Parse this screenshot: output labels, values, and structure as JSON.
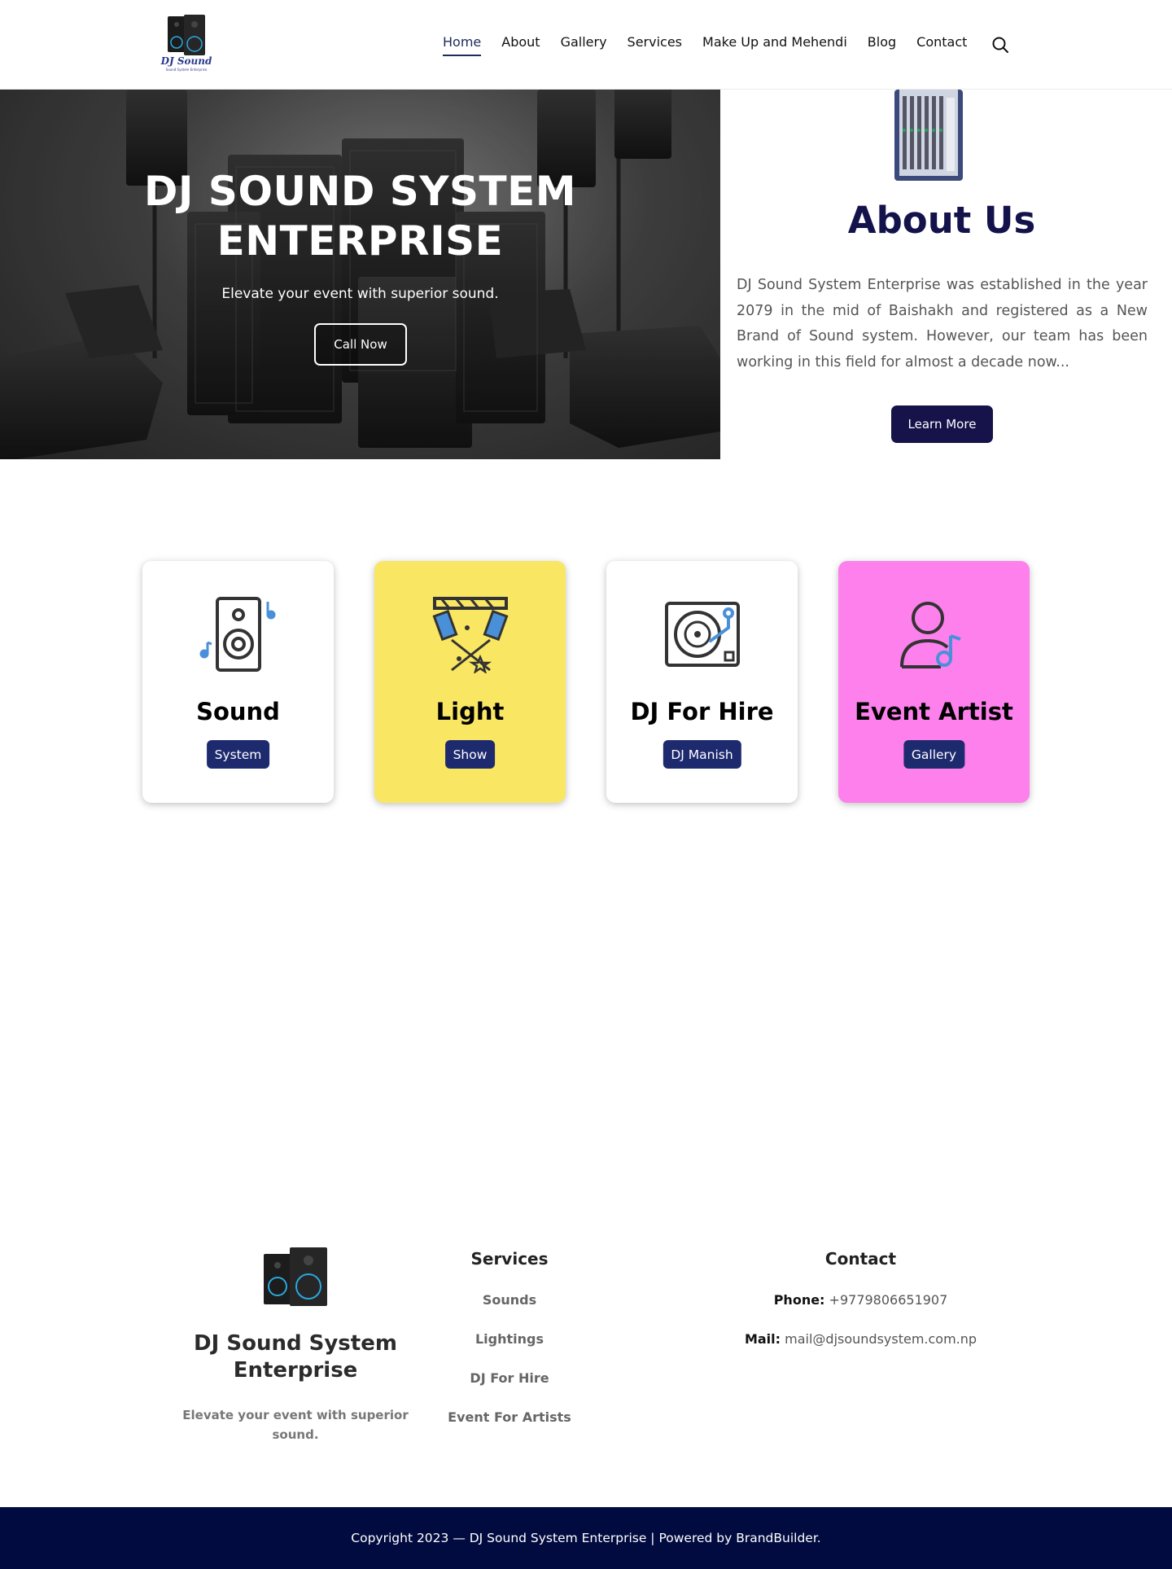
{
  "header": {
    "logo_text": "DJ Sound",
    "logo_subtext": "Sound System Enterprise",
    "nav": [
      "Home",
      "About",
      "Gallery",
      "Services",
      "Make Up and Mehendi",
      "Blog",
      "Contact"
    ],
    "active_nav": "Home"
  },
  "hero": {
    "title": "DJ SOUND SYSTEM ENTERPRISE",
    "subtitle": "Elevate your event with superior sound.",
    "cta": "Call Now"
  },
  "about": {
    "title": "About Us",
    "text": "DJ Sound System Enterprise was established in the year  2079 in the mid of Baishakh and registered as a New Brand of Sound system. However, our team has been working in this field for almost a decade now...",
    "button": "Learn More"
  },
  "cards": [
    {
      "title": "Sound",
      "badge": "System",
      "icon": "speaker-icon",
      "color": "#ffffff"
    },
    {
      "title": "Light",
      "badge": "Show",
      "icon": "stage-light-icon",
      "color": "#f9e662"
    },
    {
      "title": "DJ For Hire",
      "badge": "DJ Manish",
      "icon": "turntable-icon",
      "color": "#ffffff"
    },
    {
      "title": "Event Artist",
      "badge": "Gallery",
      "icon": "artist-icon",
      "color": "#fd80ed"
    }
  ],
  "footer": {
    "brand": "DJ Sound System Enterprise",
    "tagline": "Elevate your event with superior sound.",
    "services_title": "Services",
    "services": [
      "Sounds",
      "Lightings",
      "DJ For Hire",
      "Event For Artists"
    ],
    "contact_title": "Contact",
    "phone_label": "Phone:",
    "phone": "+9779806651907",
    "mail_label": "Mail:",
    "mail": "mail@djsoundsystem.com.np",
    "copyright": "Copyright 2023 — DJ Sound System Enterprise | Powered by BrandBuilder."
  },
  "colors": {
    "brand_navy": "#15134a",
    "badge_navy": "#1e2a6e",
    "footer_bar": "#020b3f",
    "card_yellow": "#f9e662",
    "card_pink": "#fd80ed",
    "icon_blue": "#4a90d9"
  }
}
